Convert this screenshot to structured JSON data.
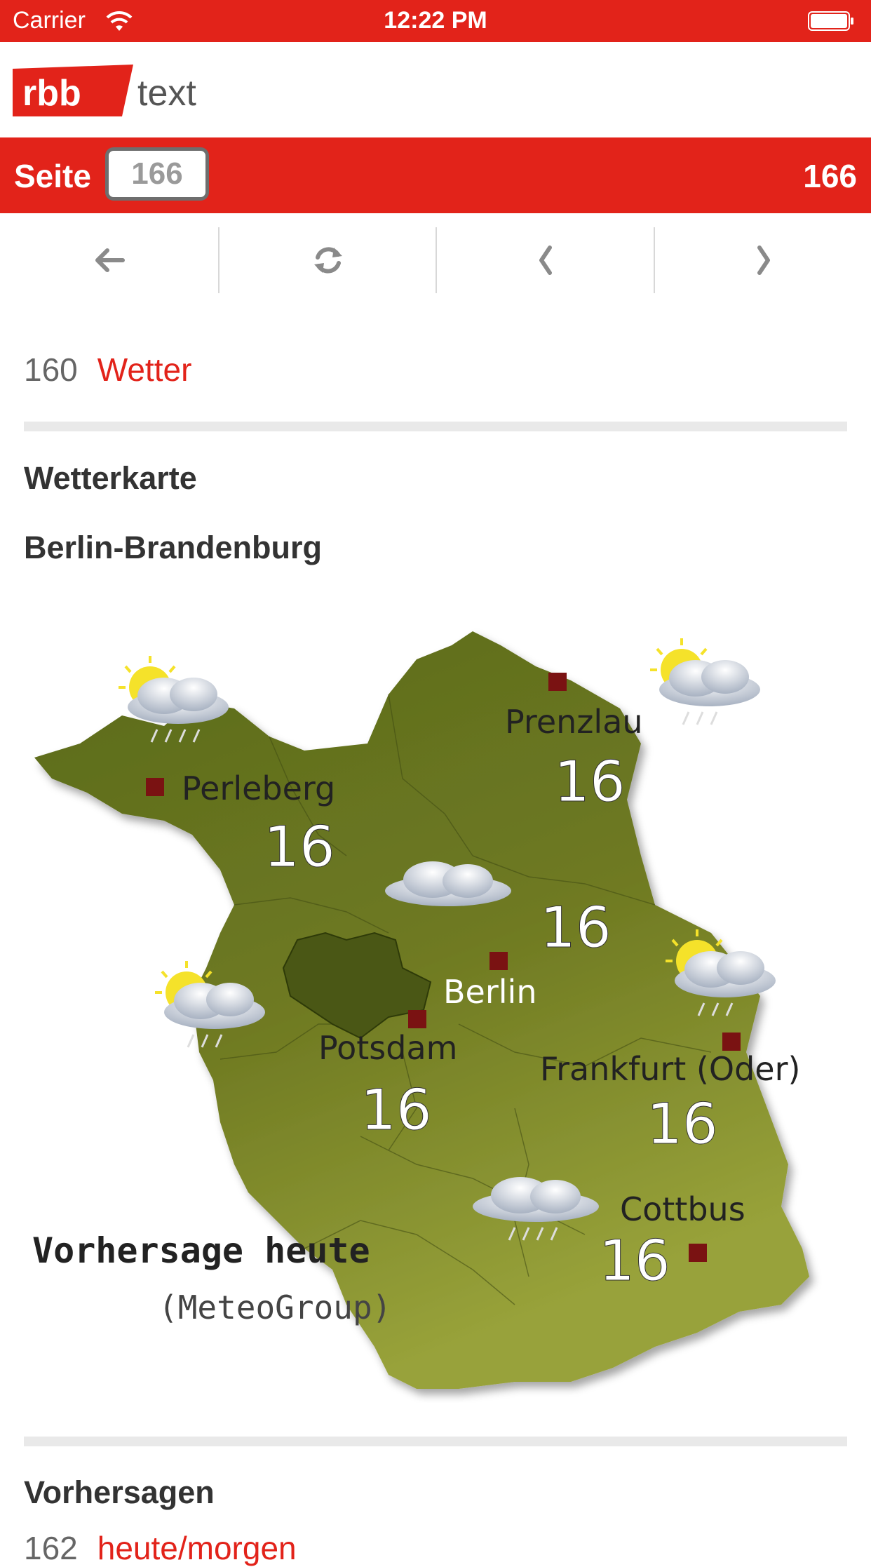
{
  "status_bar": {
    "carrier": "Carrier",
    "time": "12:22 PM"
  },
  "header": {
    "logo_text": "rbb",
    "logo_suffix": "text"
  },
  "page_bar": {
    "label": "Seite",
    "input_value": "166",
    "current_page": "166"
  },
  "nav": {
    "buttons": [
      "back-icon",
      "refresh-icon",
      "previous-icon",
      "next-icon"
    ]
  },
  "breadcrumb": {
    "number": "160",
    "link": "Wetter"
  },
  "content": {
    "heading1": "Wetterkarte",
    "heading2": "Berlin-Brandenburg",
    "heading3": "Vorhersagen"
  },
  "map": {
    "caption": "Vorhersage heute",
    "source": "(MeteoGroup)",
    "cities": [
      {
        "name": "Prenzlau",
        "temp": "16"
      },
      {
        "name": "Perleberg",
        "temp": "16"
      },
      {
        "name": "Berlin",
        "temp": "16"
      },
      {
        "name": "Potsdam",
        "temp": "16"
      },
      {
        "name": "Frankfurt (Oder)",
        "temp": "16"
      },
      {
        "name": "Cottbus",
        "temp": "16"
      }
    ]
  },
  "list": {
    "number": "162",
    "link": "heute/morgen"
  },
  "colors": {
    "brand": "#e2231a",
    "map_dark": "#5e6b1e",
    "map_light": "#8f9a30"
  }
}
